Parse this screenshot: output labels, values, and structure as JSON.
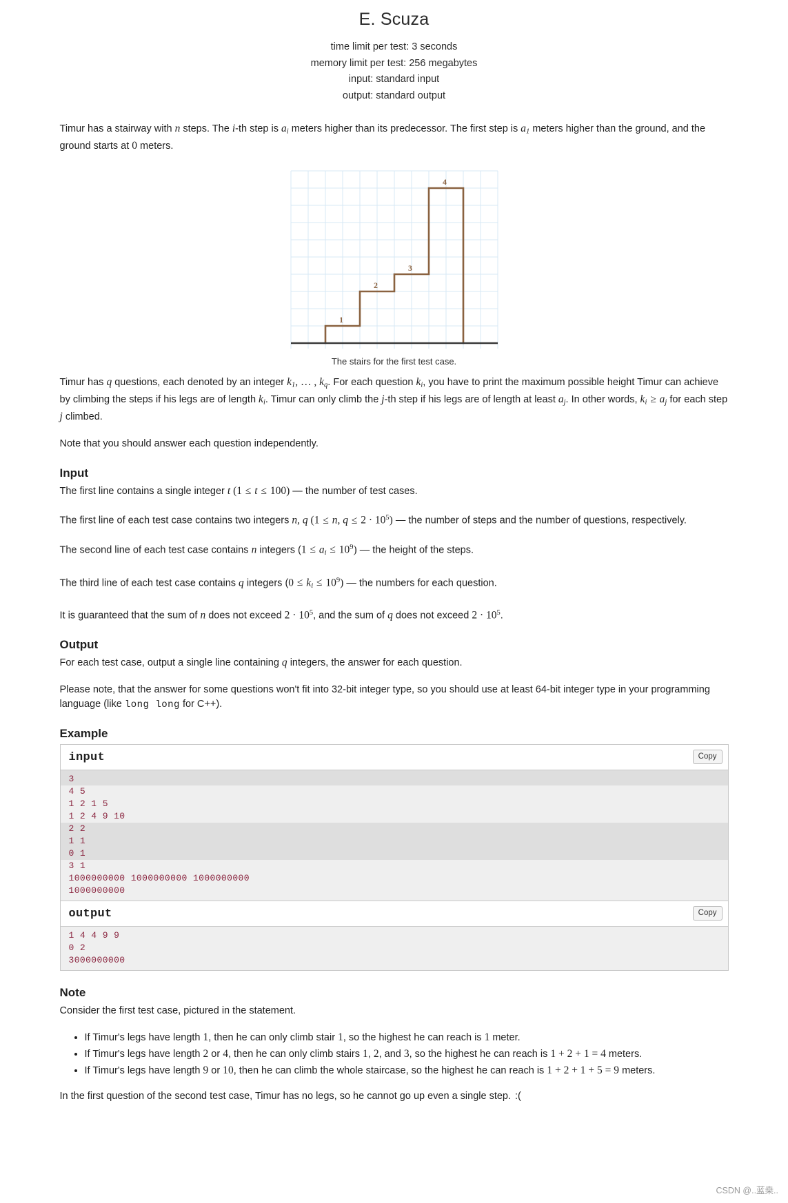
{
  "header": {
    "title": "E. Scuza",
    "time_limit": "time limit per test: 3 seconds",
    "memory_limit": "memory limit per test: 256 megabytes",
    "input_spec": "input: standard input",
    "output_spec": "output: standard output"
  },
  "statement": {
    "p1_a": "Timur has a stairway with ",
    "p1_n": "n",
    "p1_b": " steps. The ",
    "p1_i": "i",
    "p1_c": "-th step is ",
    "p1_a_var": "a",
    "p1_a_sub": "i",
    "p1_d": " meters higher than its predecessor. The first step is ",
    "p1_a1_var": "a",
    "p1_a1_sub": "1",
    "p1_e": " meters higher than the ground, and the ground starts at ",
    "p1_zero": "0",
    "p1_f": " meters.",
    "p2_a": "Timur has ",
    "p2_q": "q",
    "p2_b": " questions, each denoted by an integer ",
    "p2_k1": "k",
    "p2_k1_sub": "1",
    "p2_dots": ", … , ",
    "p2_kq": "k",
    "p2_kq_sub": "q",
    "p2_c": ". For each question ",
    "p2_ki": "k",
    "p2_ki_sub": "i",
    "p2_d": ", you have to print the maximum possible height Timur can achieve by climbing the steps if his legs are of length ",
    "p2_ki2": "k",
    "p2_ki2_sub": "i",
    "p2_e": ". Timur can only climb the ",
    "p2_j": "j",
    "p2_f": "-th step if his legs are of length at least ",
    "p2_aj": "a",
    "p2_aj_sub": "j",
    "p2_g": ". In other words, ",
    "p2_ki3": "k",
    "p2_ki3_sub": "i",
    "p2_geq": " ≥ ",
    "p2_aj2": "a",
    "p2_aj2_sub": "j",
    "p2_h": " for each step ",
    "p2_j2": "j",
    "p2_i": " climbed.",
    "p3": "Note that you should answer each question independently."
  },
  "figure": {
    "caption": "The stairs for the first test case.",
    "step_labels": [
      "1",
      "2",
      "3",
      "4"
    ],
    "stroke_color": "#8a6240",
    "grid_color": "#d7e8f5",
    "ground_color": "#3a3a3a"
  },
  "input_section": {
    "heading": "Input",
    "l1_a": "The first line contains a single integer ",
    "l1_t": "t",
    "l1_open": " (",
    "l1_one": "1",
    "l1_le1": " ≤ ",
    "l1_t2": "t",
    "l1_le2": " ≤ ",
    "l1_hundred": "100",
    "l1_close": ")",
    "l1_b": " — the number of test cases.",
    "l2_a": "The first line of each test case contains two integers ",
    "l2_n": "n",
    "l2_comma": ", ",
    "l2_q": "q",
    "l2_open": " (",
    "l2_one": "1",
    "l2_le1": " ≤ ",
    "l2_n2": "n",
    "l2_comma2": ", ",
    "l2_q2": "q",
    "l2_le2": " ≤ ",
    "l2_two": "2",
    "l2_dot": " · ",
    "l2_ten": "10",
    "l2_exp": "5",
    "l2_close": ")",
    "l2_b": " — the number of steps and the number of questions, respectively.",
    "l3_a": "The second line of each test case contains ",
    "l3_n": "n",
    "l3_b": " integers (",
    "l3_one": "1",
    "l3_le1": " ≤ ",
    "l3_a_var": "a",
    "l3_a_sub": "i",
    "l3_le2": " ≤ ",
    "l3_ten": "10",
    "l3_exp": "9",
    "l3_close": ")",
    "l3_c": " — the height of the steps.",
    "l4_a": "The third line of each test case contains ",
    "l4_q": "q",
    "l4_b": " integers (",
    "l4_zero": "0",
    "l4_le1": " ≤ ",
    "l4_k_var": "k",
    "l4_k_sub": "i",
    "l4_le2": " ≤ ",
    "l4_ten": "10",
    "l4_exp": "9",
    "l4_close": ")",
    "l4_c": " — the numbers for each question.",
    "l5_a": "It is guaranteed that the sum of ",
    "l5_n": "n",
    "l5_b": " does not exceed ",
    "l5_two": "2",
    "l5_dot": " · ",
    "l5_ten": "10",
    "l5_exp": "5",
    "l5_c": ", and the sum of ",
    "l5_q": "q",
    "l5_d": " does not exceed ",
    "l5_two2": "2",
    "l5_dot2": " · ",
    "l5_ten2": "10",
    "l5_exp2": "5",
    "l5_e": "."
  },
  "output_section": {
    "heading": "Output",
    "l1_a": "For each test case, output a single line containing ",
    "l1_q": "q",
    "l1_b": " integers, the answer for each question.",
    "l2_a": "Please note, that the answer for some questions won't fit into 32-bit integer type, so you should use at least 64-bit integer type in your programming language (like ",
    "l2_code": "long long",
    "l2_b": " for C++)."
  },
  "example": {
    "heading": "Example",
    "copy_label": "Copy",
    "input_title": "input",
    "output_title": "output",
    "input_lines": [
      "3",
      "4 5",
      "1 2 1 5",
      "1 2 4 9 10",
      "2 2",
      "1 1",
      "0 1",
      "3 1",
      "1000000000 1000000000 1000000000",
      "1000000000"
    ],
    "output_lines": [
      "1 4 4 9 9",
      "0 2",
      "3000000000"
    ]
  },
  "note_section": {
    "heading": "Note",
    "intro": "Consider the first test case, pictured in the statement.",
    "bullets": [
      {
        "a": "If Timur's legs have length ",
        "v1": "1",
        "b": ", then he can only climb stair ",
        "v2": "1",
        "c": ", so the highest he can reach is ",
        "v3": "1",
        "d": " meter."
      },
      {
        "a": "If Timur's legs have length ",
        "v1": "2",
        "b": " or ",
        "v1b": "4",
        "c": ", then he can only climb stairs ",
        "v2": "1",
        "d": ", ",
        "v2b": "2",
        "e": ", and ",
        "v2c": "3",
        "f": ", so the highest he can reach is ",
        "expr": "1 + 2 + 1 = 4",
        "g": " meters."
      },
      {
        "a": "If Timur's legs have length ",
        "v1": "9",
        "b": " or ",
        "v1b": "10",
        "c": ", then he can climb the whole staircase, so the highest he can reach is ",
        "expr": "1 + 2 + 1 + 5 = 9",
        "d": " meters."
      }
    ],
    "closing": "In the first question of the second test case, Timur has no legs, so he cannot go up even a single step.",
    "emoticon": ":("
  },
  "watermark": "CSDN @..蓝桒.."
}
